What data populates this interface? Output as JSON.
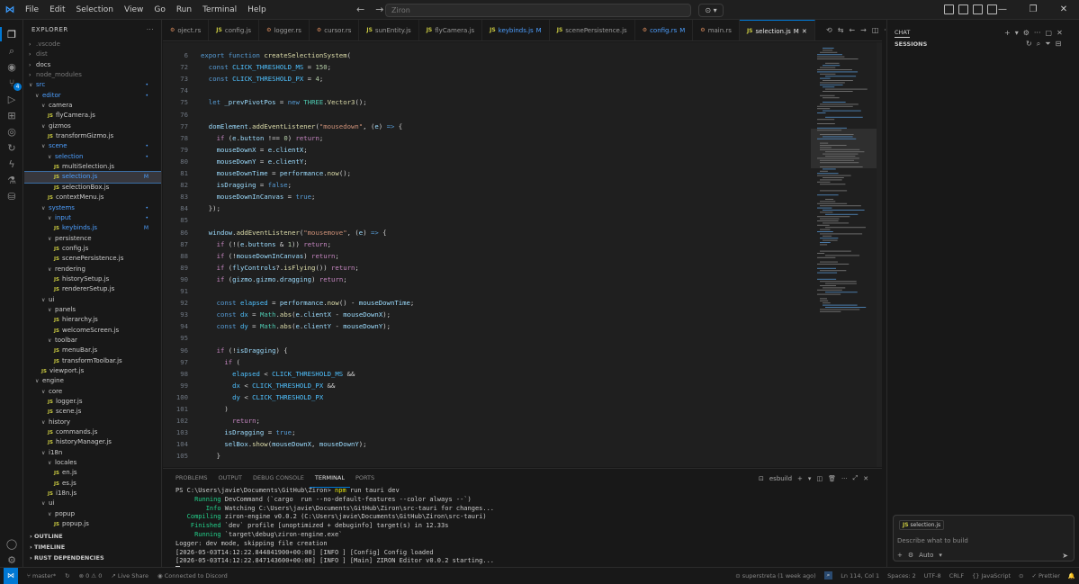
{
  "menu": [
    "File",
    "Edit",
    "Selection",
    "View",
    "Go",
    "Run",
    "Terminal",
    "Help"
  ],
  "search": {
    "placeholder": "Ziron"
  },
  "explorer": {
    "title": "EXPLORER",
    "rows": [
      {
        "label": ".vscode",
        "d": 1,
        "t": "f",
        "c": "closed",
        "st": "dim"
      },
      {
        "label": "dist",
        "d": 1,
        "t": "f",
        "c": "closed",
        "st": "dim"
      },
      {
        "label": "docs",
        "d": 1,
        "t": "f",
        "c": "closed",
        "st": ""
      },
      {
        "label": "node_modules",
        "d": 1,
        "t": "f",
        "c": "closed",
        "st": "dim"
      },
      {
        "label": "src",
        "d": 1,
        "t": "f",
        "c": "open",
        "st": "mod",
        "b": "•"
      },
      {
        "label": "editor",
        "d": 2,
        "t": "f",
        "c": "open",
        "st": "mod",
        "b": "•"
      },
      {
        "label": "camera",
        "d": 3,
        "t": "f",
        "c": "open",
        "st": ""
      },
      {
        "label": "flyCamera.js",
        "d": 4,
        "t": "js",
        "st": ""
      },
      {
        "label": "gizmos",
        "d": 3,
        "t": "f",
        "c": "open",
        "st": ""
      },
      {
        "label": "transformGizmo.js",
        "d": 4,
        "t": "js",
        "st": ""
      },
      {
        "label": "scene",
        "d": 3,
        "t": "f",
        "c": "open",
        "st": "mod",
        "b": "•"
      },
      {
        "label": "selection",
        "d": 4,
        "t": "f",
        "c": "open",
        "st": "mod",
        "b": "•"
      },
      {
        "label": "multiSelection.js",
        "d": 5,
        "t": "js",
        "st": ""
      },
      {
        "label": "selection.js",
        "d": 5,
        "t": "js",
        "st": "mod sel",
        "b": "M"
      },
      {
        "label": "selectionBox.js",
        "d": 5,
        "t": "js",
        "st": ""
      },
      {
        "label": "contextMenu.js",
        "d": 4,
        "t": "js",
        "st": ""
      },
      {
        "label": "systems",
        "d": 3,
        "t": "f",
        "c": "open",
        "st": "mod",
        "b": "•"
      },
      {
        "label": "input",
        "d": 4,
        "t": "f",
        "c": "open",
        "st": "mod",
        "b": "•"
      },
      {
        "label": "keybinds.js",
        "d": 5,
        "t": "js",
        "st": "mod",
        "b": "M"
      },
      {
        "label": "persistence",
        "d": 4,
        "t": "f",
        "c": "open",
        "st": ""
      },
      {
        "label": "config.js",
        "d": 5,
        "t": "js",
        "st": ""
      },
      {
        "label": "scenePersistence.js",
        "d": 5,
        "t": "js",
        "st": ""
      },
      {
        "label": "rendering",
        "d": 4,
        "t": "f",
        "c": "open",
        "st": ""
      },
      {
        "label": "historySetup.js",
        "d": 5,
        "t": "js",
        "st": ""
      },
      {
        "label": "rendererSetup.js",
        "d": 5,
        "t": "js",
        "st": ""
      },
      {
        "label": "ui",
        "d": 3,
        "t": "f",
        "c": "open",
        "st": ""
      },
      {
        "label": "panels",
        "d": 4,
        "t": "f",
        "c": "open",
        "st": ""
      },
      {
        "label": "hierarchy.js",
        "d": 5,
        "t": "js",
        "st": ""
      },
      {
        "label": "welcomeScreen.js",
        "d": 5,
        "t": "js",
        "st": ""
      },
      {
        "label": "toolbar",
        "d": 4,
        "t": "f",
        "c": "open",
        "st": ""
      },
      {
        "label": "menuBar.js",
        "d": 5,
        "t": "js",
        "st": ""
      },
      {
        "label": "transformToolbar.js",
        "d": 5,
        "t": "js",
        "st": ""
      },
      {
        "label": "viewport.js",
        "d": 3,
        "t": "js",
        "st": ""
      },
      {
        "label": "engine",
        "d": 2,
        "t": "f",
        "c": "open",
        "st": ""
      },
      {
        "label": "core",
        "d": 3,
        "t": "f",
        "c": "open",
        "st": ""
      },
      {
        "label": "logger.js",
        "d": 4,
        "t": "js",
        "st": ""
      },
      {
        "label": "scene.js",
        "d": 4,
        "t": "js",
        "st": ""
      },
      {
        "label": "history",
        "d": 3,
        "t": "f",
        "c": "open",
        "st": ""
      },
      {
        "label": "commands.js",
        "d": 4,
        "t": "js",
        "st": ""
      },
      {
        "label": "historyManager.js",
        "d": 4,
        "t": "js",
        "st": ""
      },
      {
        "label": "i18n",
        "d": 3,
        "t": "f",
        "c": "open",
        "st": ""
      },
      {
        "label": "locales",
        "d": 4,
        "t": "f",
        "c": "open",
        "st": ""
      },
      {
        "label": "en.js",
        "d": 5,
        "t": "js",
        "st": ""
      },
      {
        "label": "es.js",
        "d": 5,
        "t": "js",
        "st": ""
      },
      {
        "label": "i18n.js",
        "d": 4,
        "t": "js",
        "st": ""
      },
      {
        "label": "ui",
        "d": 3,
        "t": "f",
        "c": "open",
        "st": ""
      },
      {
        "label": "popup",
        "d": 4,
        "t": "f",
        "c": "open",
        "st": ""
      },
      {
        "label": "popup.js",
        "d": 5,
        "t": "js",
        "st": ""
      }
    ],
    "sections": [
      "OUTLINE",
      "TIMELINE",
      "RUST DEPENDENCIES"
    ]
  },
  "tabs": [
    {
      "label": "oject.rs",
      "icon": "rs",
      "st": ""
    },
    {
      "label": "config.js",
      "icon": "js",
      "st": ""
    },
    {
      "label": "logger.rs",
      "icon": "rs",
      "st": ""
    },
    {
      "label": "cursor.rs",
      "icon": "rs",
      "st": ""
    },
    {
      "label": "sunEntity.js",
      "icon": "js",
      "st": ""
    },
    {
      "label": "flyCamera.js",
      "icon": "js",
      "st": ""
    },
    {
      "label": "keybinds.js",
      "icon": "js",
      "st": "mod",
      "m": "M"
    },
    {
      "label": "scenePersistence.js",
      "icon": "js",
      "st": ""
    },
    {
      "label": "config.rs",
      "icon": "rs",
      "st": "mod",
      "m": "M"
    },
    {
      "label": "main.rs",
      "icon": "rs",
      "st": ""
    },
    {
      "label": "selection.js",
      "icon": "js",
      "st": "mod active",
      "m": "M"
    }
  ],
  "code": [
    {
      "n": "6",
      "h": "<span class='kw'>export</span> <span class='kw'>function</span> <span class='fn'>createSelectionSystem</span>("
    },
    {
      "n": "72",
      "h": "  <span class='kw'>const</span> <span class='cst'>CLICK_THRESHOLD_MS</span> = <span class='num'>150</span>;"
    },
    {
      "n": "73",
      "h": "  <span class='kw'>const</span> <span class='cst'>CLICK_THRESHOLD_PX</span> = <span class='num'>4</span>;"
    },
    {
      "n": "74",
      "h": ""
    },
    {
      "n": "75",
      "h": "  <span class='kw'>let</span> <span class='prop'>_prevPivotPos</span> = <span class='kw'>new</span> <span class='cls'>THREE</span>.<span class='fn'>Vector3</span>();"
    },
    {
      "n": "76",
      "h": ""
    },
    {
      "n": "77",
      "h": "  <span class='prop'>domElement</span>.<span class='fn'>addEventListener</span>(<span class='str'>\"mousedown\"</span>, (<span class='prop'>e</span>) <span class='kw'>=&gt;</span> {"
    },
    {
      "n": "78",
      "h": "    <span class='ctl'>if</span> (<span class='prop'>e</span>.<span class='prop'>button</span> !== <span class='num'>0</span>) <span class='ctl'>return</span>;"
    },
    {
      "n": "79",
      "h": "    <span class='prop'>mouseDownX</span> = <span class='prop'>e</span>.<span class='prop'>clientX</span>;"
    },
    {
      "n": "80",
      "h": "    <span class='prop'>mouseDownY</span> = <span class='prop'>e</span>.<span class='prop'>clientY</span>;"
    },
    {
      "n": "81",
      "h": "    <span class='prop'>mouseDownTime</span> = <span class='prop'>performance</span>.<span class='fn'>now</span>();"
    },
    {
      "n": "82",
      "h": "    <span class='prop'>isDragging</span> = <span class='kw'>false</span>;"
    },
    {
      "n": "83",
      "h": "    <span class='prop'>mouseDownInCanvas</span> = <span class='kw'>true</span>;"
    },
    {
      "n": "84",
      "h": "  });"
    },
    {
      "n": "85",
      "h": ""
    },
    {
      "n": "86",
      "h": "  <span class='prop'>window</span>.<span class='fn'>addEventListener</span>(<span class='str'>\"mousemove\"</span>, (<span class='prop'>e</span>) <span class='kw'>=&gt;</span> {"
    },
    {
      "n": "87",
      "h": "    <span class='ctl'>if</span> (!(<span class='prop'>e</span>.<span class='prop'>buttons</span> &amp; <span class='num'>1</span>)) <span class='ctl'>return</span>;"
    },
    {
      "n": "88",
      "h": "    <span class='ctl'>if</span> (!<span class='prop'>mouseDownInCanvas</span>) <span class='ctl'>return</span>;"
    },
    {
      "n": "89",
      "h": "    <span class='ctl'>if</span> (<span class='prop'>flyControls</span>?.<span class='fn'>isFlying</span>()) <span class='ctl'>return</span>;"
    },
    {
      "n": "90",
      "h": "    <span class='ctl'>if</span> (<span class='prop'>gizmo</span>.<span class='prop'>gizmo</span>.<span class='prop'>dragging</span>) <span class='ctl'>return</span>;"
    },
    {
      "n": "91",
      "h": ""
    },
    {
      "n": "92",
      "h": "    <span class='kw'>const</span> <span class='cst'>elapsed</span> = <span class='prop'>performance</span>.<span class='fn'>now</span>() - <span class='prop'>mouseDownTime</span>;"
    },
    {
      "n": "93",
      "h": "    <span class='kw'>const</span> <span class='cst'>dx</span> = <span class='cls'>Math</span>.<span class='fn'>abs</span>(<span class='prop'>e</span>.<span class='prop'>clientX</span> - <span class='prop'>mouseDownX</span>);"
    },
    {
      "n": "94",
      "h": "    <span class='kw'>const</span> <span class='cst'>dy</span> = <span class='cls'>Math</span>.<span class='fn'>abs</span>(<span class='prop'>e</span>.<span class='prop'>clientY</span> - <span class='prop'>mouseDownY</span>);"
    },
    {
      "n": "95",
      "h": ""
    },
    {
      "n": "96",
      "h": "    <span class='ctl'>if</span> (!<span class='prop'>isDragging</span>) {"
    },
    {
      "n": "97",
      "h": "      <span class='ctl'>if</span> ("
    },
    {
      "n": "98",
      "h": "        <span class='cst'>elapsed</span> &lt; <span class='cst'>CLICK_THRESHOLD_MS</span> &amp;&amp;"
    },
    {
      "n": "99",
      "h": "        <span class='cst'>dx</span> &lt; <span class='cst'>CLICK_THRESHOLD_PX</span> &amp;&amp;"
    },
    {
      "n": "100",
      "h": "        <span class='cst'>dy</span> &lt; <span class='cst'>CLICK_THRESHOLD_PX</span>"
    },
    {
      "n": "101",
      "h": "      )"
    },
    {
      "n": "102",
      "h": "        <span class='ctl'>return</span>;"
    },
    {
      "n": "103",
      "h": "      <span class='prop'>isDragging</span> = <span class='kw'>true</span>;"
    },
    {
      "n": "104",
      "h": "      <span class='prop'>selBox</span>.<span class='fn'>show</span>(<span class='prop'>mouseDownX</span>, <span class='prop'>mouseDownY</span>);"
    },
    {
      "n": "105",
      "h": "    }"
    }
  ],
  "panel": {
    "tabs": [
      "PROBLEMS",
      "OUTPUT",
      "DEBUG CONSOLE",
      "TERMINAL",
      "PORTS"
    ],
    "active": "TERMINAL",
    "shell": "esbuild",
    "lines": [
      {
        "p": "",
        "g": "",
        "t": "PS C:\\Users\\javie\\Documents\\GitHub\\Ziron> ",
        "y": "npm",
        "r": " run tauri dev"
      },
      {
        "p": "     ",
        "g": "Running",
        "t": " DevCommand (`cargo  run --no-default-features --color always --`)",
        "y": "",
        "r": ""
      },
      {
        "p": "        ",
        "g": "Info",
        "t": " Watching C:\\Users\\javie\\Documents\\GitHub\\Ziron\\src-tauri for changes...",
        "y": "",
        "r": ""
      },
      {
        "p": "   ",
        "g": "Compiling",
        "t": " ziron-engine v0.0.2 (C:\\Users\\javie\\Documents\\GitHub\\Ziron\\src-tauri)",
        "y": "",
        "r": ""
      },
      {
        "p": "    ",
        "g": "Finished",
        "t": " `dev` profile [unoptimized + debuginfo] target(s) in 12.33s",
        "y": "",
        "r": ""
      },
      {
        "p": "     ",
        "g": "Running",
        "t": " `target\\debug\\ziron-engine.exe`",
        "y": "",
        "r": ""
      },
      {
        "p": "",
        "g": "",
        "t": "Logger: dev mode, skipping file creation",
        "y": "",
        "r": ""
      },
      {
        "p": "",
        "g": "",
        "t": "[2026-05-03T14:12:22.844841900+00:00] [INFO ] [Config] Config loaded",
        "y": "",
        "r": ""
      },
      {
        "p": "",
        "g": "",
        "t": "[2026-05-03T14:12:22.847143600+00:00] [INFO ] [Main] ZIRON Editor v0.0.2 starting...",
        "y": "",
        "r": ""
      }
    ]
  },
  "chat": {
    "title": "CHAT",
    "sessions": "SESSIONS",
    "chip": "selection.js",
    "placeholder": "Describe what to build",
    "mode": "Auto"
  },
  "status": {
    "branch": "master*",
    "problems": "⊗ 0  ⚠ 0",
    "liveshare": "Live Share",
    "discord": "Connected to Discord",
    "blame": "superstreta (1 week ago)",
    "pos": "Ln 114, Col 1",
    "spaces": "Spaces: 2",
    "enc": "UTF-8",
    "eol": "CRLF",
    "lang": "{} JavaScript",
    "prettier": "✓ Prettier"
  },
  "colors": {
    "accent": "#0078d4",
    "modified": "#4d9fff",
    "js": "#cbcb41",
    "terminalGreen": "#23d18b",
    "terminalYellow": "#e5e510"
  }
}
